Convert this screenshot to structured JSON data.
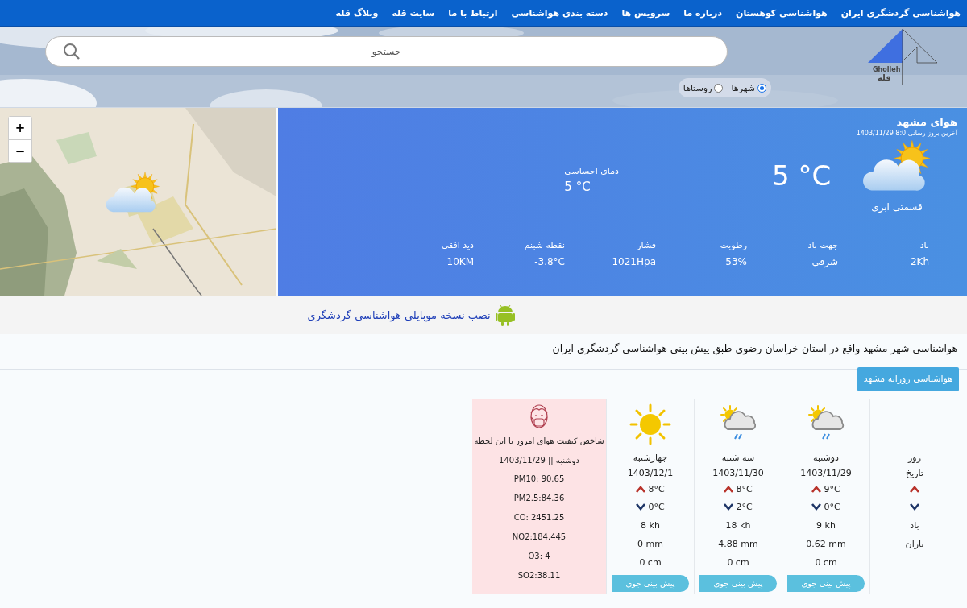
{
  "nav": {
    "items": [
      {
        "label": "هواشناسی گردشگری ایران"
      },
      {
        "label": "هواشناسی کوهستان"
      },
      {
        "label": "درباره ما"
      },
      {
        "label": "سرویس ها"
      },
      {
        "label": "دسته بندی هواشناسی"
      },
      {
        "label": "ارتباط با ما"
      },
      {
        "label": "سایت قله"
      },
      {
        "label": "وبلاگ قله"
      }
    ]
  },
  "header": {
    "logo": {
      "latin": "Gholleh",
      "persian": "قله"
    },
    "search": {
      "placeholder": "جستجو"
    },
    "scope": [
      {
        "label": "شهرها",
        "selected": true
      },
      {
        "label": "روستاها",
        "selected": false
      }
    ]
  },
  "current": {
    "title": "هوای مشهد",
    "updated": "آخرین بروز رسانی 8:0 1403/11/29",
    "condition": "قسمتی ابری",
    "temperature": "5 °C",
    "feels_like": {
      "label": "دمای احساسی",
      "value": "5 °C"
    },
    "stats": [
      {
        "label": "باد",
        "value": "2Kh"
      },
      {
        "label": "جهت باد",
        "value": "شرقی"
      },
      {
        "label": "رطوبت",
        "value": "53%"
      },
      {
        "label": "فشار",
        "value": "1021Hpa"
      },
      {
        "label": "نقطه شبنم",
        "value": "-3.8°C"
      },
      {
        "label": "دید افقی",
        "value": "10KM"
      }
    ]
  },
  "map": {
    "zoom_in": "+",
    "zoom_out": "−"
  },
  "app_banner": {
    "link": "نصب نسخه موبایلی هواشناسی گردشگری"
  },
  "description": "هواشناسی شهر مشهد واقع در استان خراسان رضوی طبق پیش بینی هواشناسی گردشگری ایران",
  "daily_button": "هواشناسی روزانه مشهد",
  "forecast": {
    "labels": {
      "day": "روز",
      "date": "تاریخ",
      "wind": "باد",
      "rain": "باران"
    },
    "days": [
      {
        "kind": "sun-cloud-rain",
        "day": "دوشنبه",
        "date": "1403/11/29",
        "high": "9°C",
        "low": "0°C",
        "wind": "9 kh",
        "rain": "0.62 mm",
        "snow": "0 cm",
        "button": "پیش بینی جوی"
      },
      {
        "kind": "sun-cloud-rain",
        "day": "سه شنبه",
        "date": "1403/11/30",
        "high": "8°C",
        "low": "2°C",
        "wind": "18 kh",
        "rain": "4.88 mm",
        "snow": "0 cm",
        "button": "پیش بینی جوی"
      },
      {
        "kind": "sun",
        "day": "چهارشنبه",
        "date": "1403/12/1",
        "high": "8°C",
        "low": "0°C",
        "wind": "8 kh",
        "rain": "0 mm",
        "snow": "0 cm",
        "button": "پیش بینی جوی"
      }
    ]
  },
  "air_quality": {
    "title": "شاخص کیفیت هوای امروز تا این لحظه",
    "date": "دوشنبه || 1403/11/29",
    "readings": [
      "PM10: 90.65",
      "PM2.5:84.36",
      "CO: 2451.25",
      "NO2:184.445",
      "O3: 4",
      "SO2:38.11"
    ]
  }
}
